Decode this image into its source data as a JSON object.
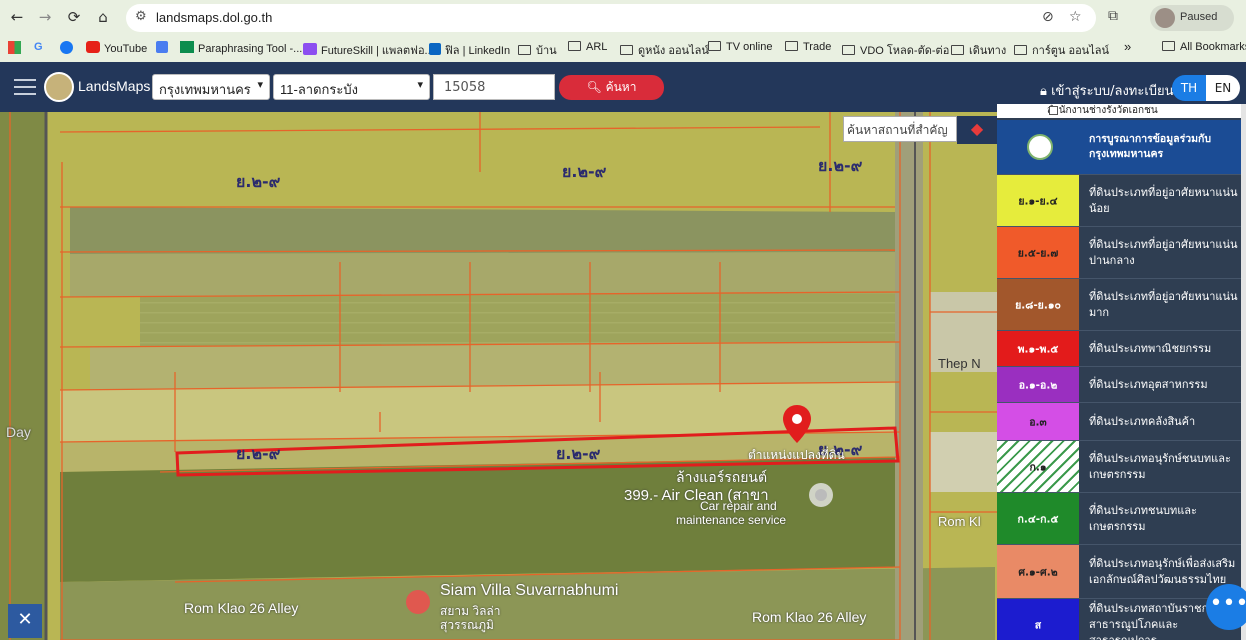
{
  "browser": {
    "url": "landsmaps.dol.go.th",
    "profile_status": "Paused",
    "bookmarks": [
      "YouTube",
      "Paraphrasing Tool -...",
      "FutureSkill | แพลตฟอ...",
      "ฟิล | LinkedIn",
      "บ้าน",
      "ARL",
      "ดูหนัง ออนไลน์",
      "TV online",
      "Trade",
      "VDO โหลด-ตัด-ต่อ",
      "เดินทาง",
      "การ์ตูน ออนไลน์"
    ],
    "more": "»",
    "all_bookmarks": "All Bookmarks"
  },
  "header": {
    "brand": "LandsMaps",
    "province": "กรุงเทพมหานคร",
    "district": "11-ลาดกระบัง",
    "parcel_no": "15058",
    "search_label": "ค้นหา",
    "login_label": "เข้าสู่ระบบ/ลงทะเบียน",
    "lang_th": "TH",
    "lang_en": "EN"
  },
  "map": {
    "zone_label": "ย.๒-๙",
    "parcel_tag": "ตำแหน่งแปลงที่ดิน",
    "poi_1": "ล้างแอร์รถยนต์",
    "poi_2": "399.- Air Clean (สาขา",
    "poi_3": "Car repair and",
    "poi_4": "maintenance service",
    "poi_5": "Siam Villa Suvarnabhumi",
    "poi_6": "สยาม วิลล่า",
    "poi_7": "สุวรรณภูมิ",
    "road_1": "Rom Klao 26 Alley",
    "road_2": "Rom Klao 26 Alley",
    "road_3": "Rom Kl",
    "thep": "Thep N",
    "day": "Day",
    "place_search_placeholder": "ค้นหาสถานที่สำคัญ"
  },
  "legend": {
    "top_checkbox": "สำนักงานช่างรังวัดเอกชน",
    "header": "การบูรณาการข้อมูลร่วมกับ กรุงเทพมหานคร",
    "rows": [
      {
        "code": "ย.๑-ย.๔",
        "desc": "ที่ดินประเภทที่อยู่อาศัยหนาแน่นน้อย",
        "color": "#e6ec3c"
      },
      {
        "code": "ย.๕-ย.๗",
        "desc": "ที่ดินประเภทที่อยู่อาศัยหนาแน่นปานกลาง",
        "color": "#f05a2a"
      },
      {
        "code": "ย.๘-ย.๑๐",
        "desc": "ที่ดินประเภทที่อยู่อาศัยหนาแน่นมาก",
        "color": "#a2572c"
      },
      {
        "code": "พ.๑-พ.๕",
        "desc": "ที่ดินประเภทพาณิชยกรรม",
        "color": "#e31b1b"
      },
      {
        "code": "อ.๑-อ.๒",
        "desc": "ที่ดินประเภทอุตสาหกรรม",
        "color": "#9a2fc0"
      },
      {
        "code": "อ.๓",
        "desc": "ที่ดินประเภทคลังสินค้า",
        "color": "#d44ee6"
      },
      {
        "code": "ก.๑",
        "desc": "ที่ดินประเภทอนุรักษ์ชนบทและเกษตรกรรม",
        "color": "#ffffff"
      },
      {
        "code": "ก.๔-ก.๕",
        "desc": "ที่ดินประเภทชนบทและเกษตรกรรม",
        "color": "#1f8a2a"
      },
      {
        "code": "ศ.๑-ศ.๒",
        "desc": "ที่ดินประเภทอนุรักษ์เพื่อส่งเสริมเอกลักษณ์ศิลปวัฒนธรรมไทย",
        "color": "#e98a66"
      },
      {
        "code": "ส",
        "desc": "ที่ดินประเภทสถาบันราชการ สาธารณูปโภคและสาธารณูปการ",
        "color": "#1c1ccf"
      }
    ]
  }
}
